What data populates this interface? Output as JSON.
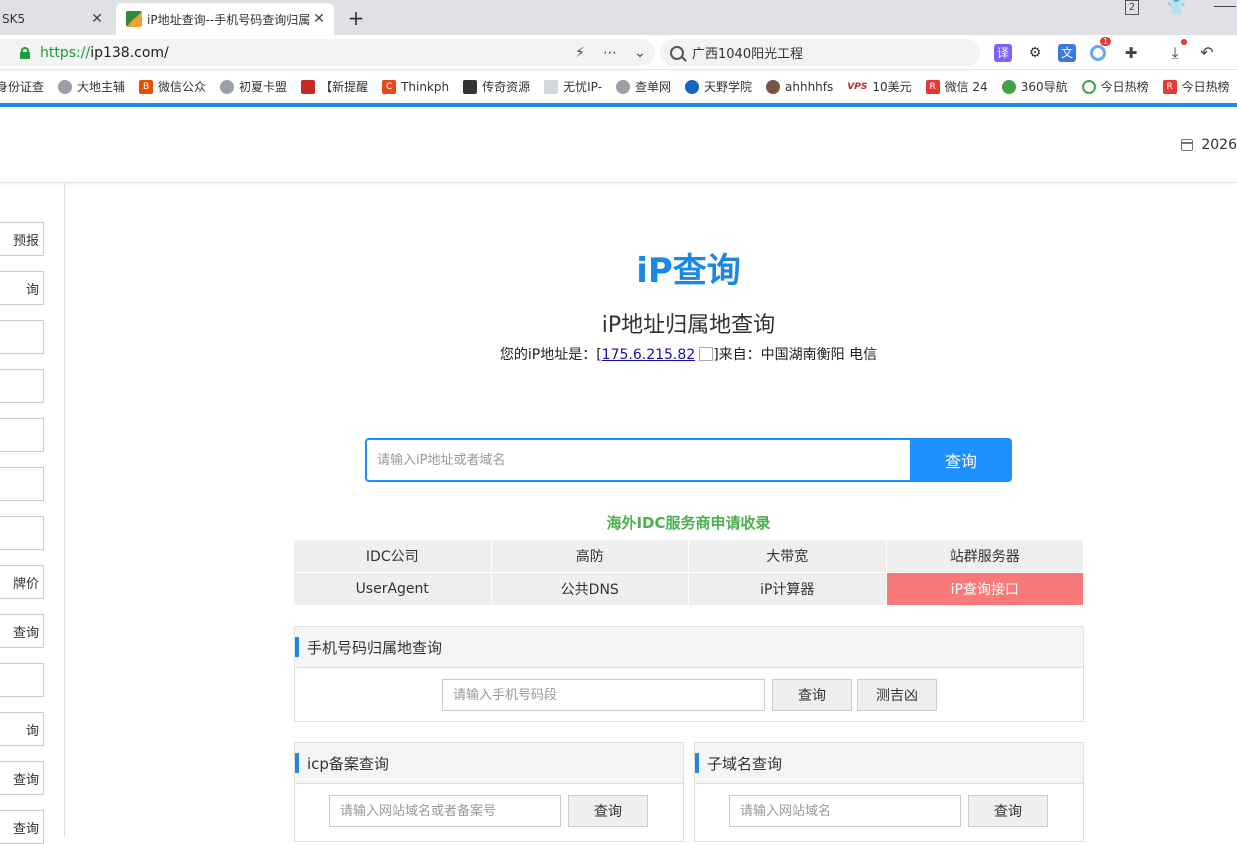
{
  "browser": {
    "tabs": [
      {
        "title": "SK5",
        "active": false
      },
      {
        "title": "iP地址查询--手机号码查询归属地",
        "active": true
      }
    ],
    "new_tab": "+",
    "window_controls": {
      "badge": "2"
    },
    "url_scheme": "https://",
    "url_host": "ip138.com/",
    "search_text": "广西1040阳光工程",
    "ext_badge": "1"
  },
  "bookmarks": [
    "身份证查",
    "大地主辅",
    "微信公众",
    "初夏卡盟",
    "【新提醒",
    "Thinkph",
    "传奇资源",
    "无忧IP-",
    "查单网",
    "天野学院",
    "ahhhhfs",
    "10美元",
    "微信 24",
    "360导航",
    "今日热榜",
    "今日热榜"
  ],
  "bookmark_prefix_vps": "VPS",
  "header": {
    "date": "2026"
  },
  "sidebar": {
    "items": [
      "预报",
      "询",
      "",
      "",
      "",
      "",
      "",
      "牌价",
      "查询",
      "",
      "询",
      "查询",
      "查询"
    ]
  },
  "main": {
    "logo": "iP查询",
    "title": "iP地址归属地查询",
    "ip_prefix": "您的iP地址是：[",
    "ip_address": "175.6.215.82",
    "ip_suffix": "]来自：中国湖南衡阳 电信",
    "search_placeholder": "请输入iP地址或者域名",
    "search_button": "查询",
    "idc_title": "海外IDC服务商申请收录",
    "nav": [
      "IDC公司",
      "高防",
      "大带宽",
      "站群服务器",
      "UserAgent",
      "公共DNS",
      "iP计算器",
      "iP查询接口"
    ]
  },
  "phone_panel": {
    "title": "手机号码归属地查询",
    "placeholder": "请输入手机号码段",
    "query_button": "查询",
    "fortune_button": "测吉凶"
  },
  "icp_panel": {
    "title": "icp备案查询",
    "placeholder": "请输入网站域名或者备案号",
    "query_button": "查询"
  },
  "subdomain_panel": {
    "title": "子域名查询",
    "placeholder": "请输入网站域名",
    "query_button": "查询"
  }
}
